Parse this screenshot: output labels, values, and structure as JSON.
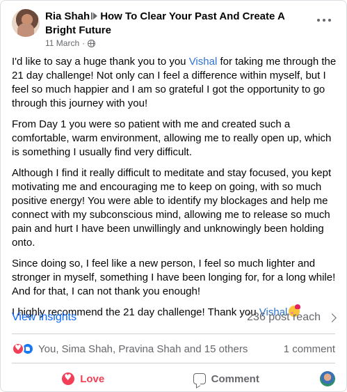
{
  "post": {
    "author": "Ria Shah",
    "group_title": "How To Clear Your Past And Create A Bright Future",
    "date": "11 March",
    "dot": "·",
    "privacy_icon": "globe-icon",
    "more_icon": "more-options-icon"
  },
  "body": {
    "p1_before": "I'd like to say a huge thank you to you ",
    "p1_mention": "Vishal",
    "p1_after": " for taking me through the 21 day challenge! Not only can I feel a difference within myself, but I feel so much happier and I am so grateful I got the opportunity to go through this journey with you!",
    "p2": "From Day 1 you were so patient with me and created such a comfortable, warm environment, allowing me to really open up, which is something I usually find very difficult.",
    "p3": "Although I find it really difficult to meditate and stay focused, you kept motivating me and encouraging me to keep on going, with so much positive energy! You were able to identify my blockages and help me connect with my subconscious mind, allowing me to release so much pain and hurt I have been unwillingly and unknowingly been holding onto.",
    "p4": "Since doing so, I feel like a new person, I feel so much lighter and stronger in myself, something I have been longing for, for a long while! And for that, I can not thank you enough!",
    "p5_before": "I highly recommend the 21 day challenge! Thank you ",
    "p5_mention": "Vishal",
    "p5_emoji": "smiling-face-with-hearts-emoji"
  },
  "insights": {
    "link_label": "View insights",
    "reach": "236 post reach"
  },
  "reactions": {
    "names": "You, Sima Shah, Pravina Shah and 15 others",
    "comment_count": "1 comment"
  },
  "actions": {
    "love_label": "Love",
    "comment_label": "Comment"
  },
  "colors": {
    "link_blue": "#0866ff",
    "mention_blue": "#2d72d2",
    "love_red": "#f33e58",
    "secondary_text": "#65676b"
  }
}
